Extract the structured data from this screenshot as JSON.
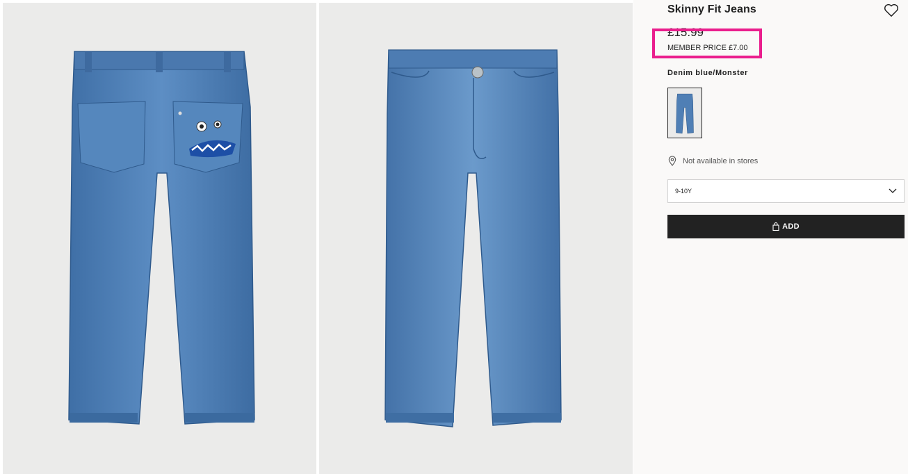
{
  "product": {
    "title": "Skinny Fit Jeans",
    "price": "£15.99",
    "member_price": "MEMBER PRICE £7.00",
    "color_name": "Denim blue/Monster",
    "availability": "Not available in stores",
    "selected_size": "9-10Y",
    "add_label": "ADD"
  },
  "icons": {
    "favorite": "heart-icon",
    "location": "location-pin-icon",
    "dropdown": "chevron-down-icon",
    "bag": "shopping-bag-icon"
  },
  "colors": {
    "accent_highlight": "#ea1e8d",
    "button": "#222222",
    "denim": "#4f7fb5"
  }
}
